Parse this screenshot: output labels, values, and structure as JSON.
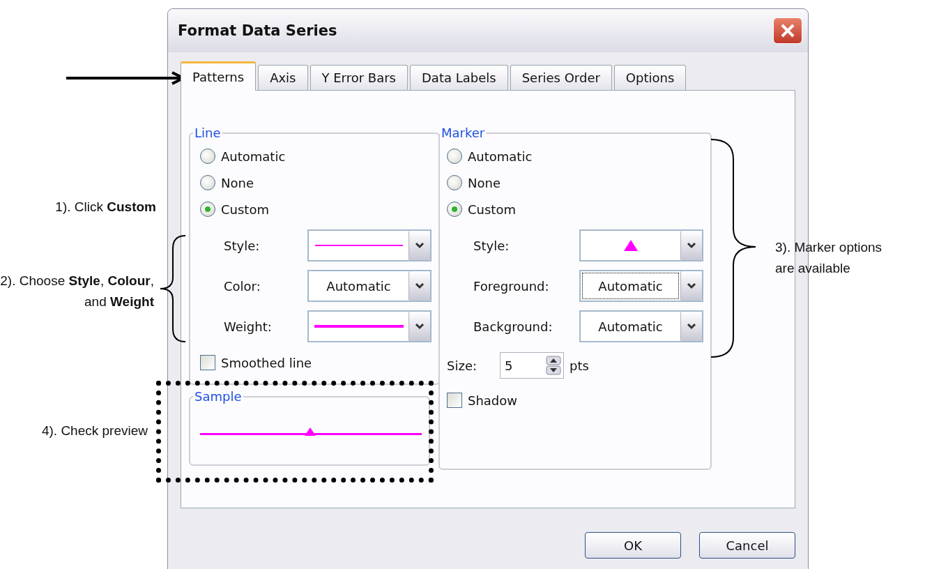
{
  "window": {
    "title": "Format Data Series"
  },
  "tabs": [
    {
      "label": "Patterns",
      "selected": true
    },
    {
      "label": "Axis",
      "selected": false
    },
    {
      "label": "Y Error Bars",
      "selected": false
    },
    {
      "label": "Data Labels",
      "selected": false
    },
    {
      "label": "Series Order",
      "selected": false
    },
    {
      "label": "Options",
      "selected": false
    }
  ],
  "line": {
    "title": "Line",
    "options": [
      {
        "label": "Automatic",
        "selected": false
      },
      {
        "label": "None",
        "selected": false
      },
      {
        "label": "Custom",
        "selected": true
      }
    ],
    "fields": [
      {
        "label": "Style:",
        "kind": "line",
        "focused": false
      },
      {
        "label": "Color:",
        "kind": "text",
        "value": "Automatic",
        "focused": false
      },
      {
        "label": "Weight:",
        "kind": "weight",
        "focused": false
      }
    ],
    "smoothed_line": {
      "label": "Smoothed line",
      "checked": false
    }
  },
  "sample": {
    "title": "Sample"
  },
  "marker": {
    "title": "Marker",
    "options": [
      {
        "label": "Automatic",
        "selected": false
      },
      {
        "label": "None",
        "selected": false
      },
      {
        "label": "Custom",
        "selected": true
      }
    ],
    "fields": [
      {
        "label": "Style:",
        "kind": "marker",
        "focused": false
      },
      {
        "label": "Foreground:",
        "kind": "text",
        "value": "Automatic",
        "focused": true
      },
      {
        "label": "Background:",
        "kind": "text",
        "value": "Automatic",
        "focused": false
      }
    ],
    "size": {
      "label": "Size:",
      "value": "5",
      "unit": "pts"
    },
    "shadow": {
      "label": "Shadow",
      "checked": false
    }
  },
  "buttons": [
    "OK",
    "Cancel"
  ],
  "annotations": [
    {
      "text": "1).  Click **Custom**"
    },
    {
      "text": "2). Choose **Style**, **Colour**, and **Weight**"
    },
    {
      "text": "3).  Marker options are available"
    },
    {
      "text": "4).  Check preview"
    }
  ]
}
